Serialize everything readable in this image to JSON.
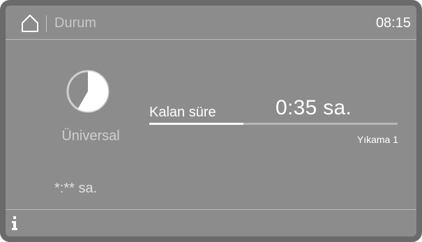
{
  "header": {
    "title": "Durum",
    "time": "08:15",
    "home_icon": "home-icon"
  },
  "program": {
    "icon": "program-status-icon",
    "name": "Üniversal",
    "duration": "*:** sa."
  },
  "remaining": {
    "label": "Kalan süre",
    "value": "0:35 sa.",
    "progress_fraction": 0.38,
    "phase": "Yıkama 1"
  },
  "footer": {
    "info_icon": "info-icon"
  },
  "colors": {
    "screen": "#8c8c8c",
    "bezel": "#6a6a6a",
    "text": "#ffffff",
    "dim_text": "#c8c8c8",
    "divider": "#b9b9b9"
  }
}
